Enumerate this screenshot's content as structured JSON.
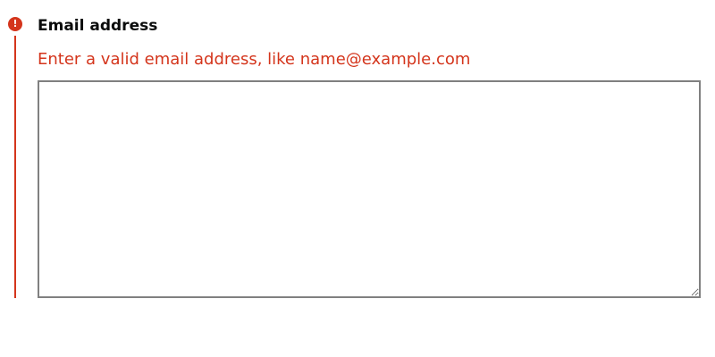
{
  "form": {
    "field": {
      "label": "Email address",
      "error_message": "Enter a valid email address, like name@example.com",
      "value": "",
      "error_icon_glyph": "!"
    }
  },
  "icons": {
    "error": "exclamation-circle-icon"
  },
  "colors": {
    "error": "#d4351c",
    "text": "#0b0c0c",
    "input_border": "#808080",
    "background": "#ffffff"
  }
}
